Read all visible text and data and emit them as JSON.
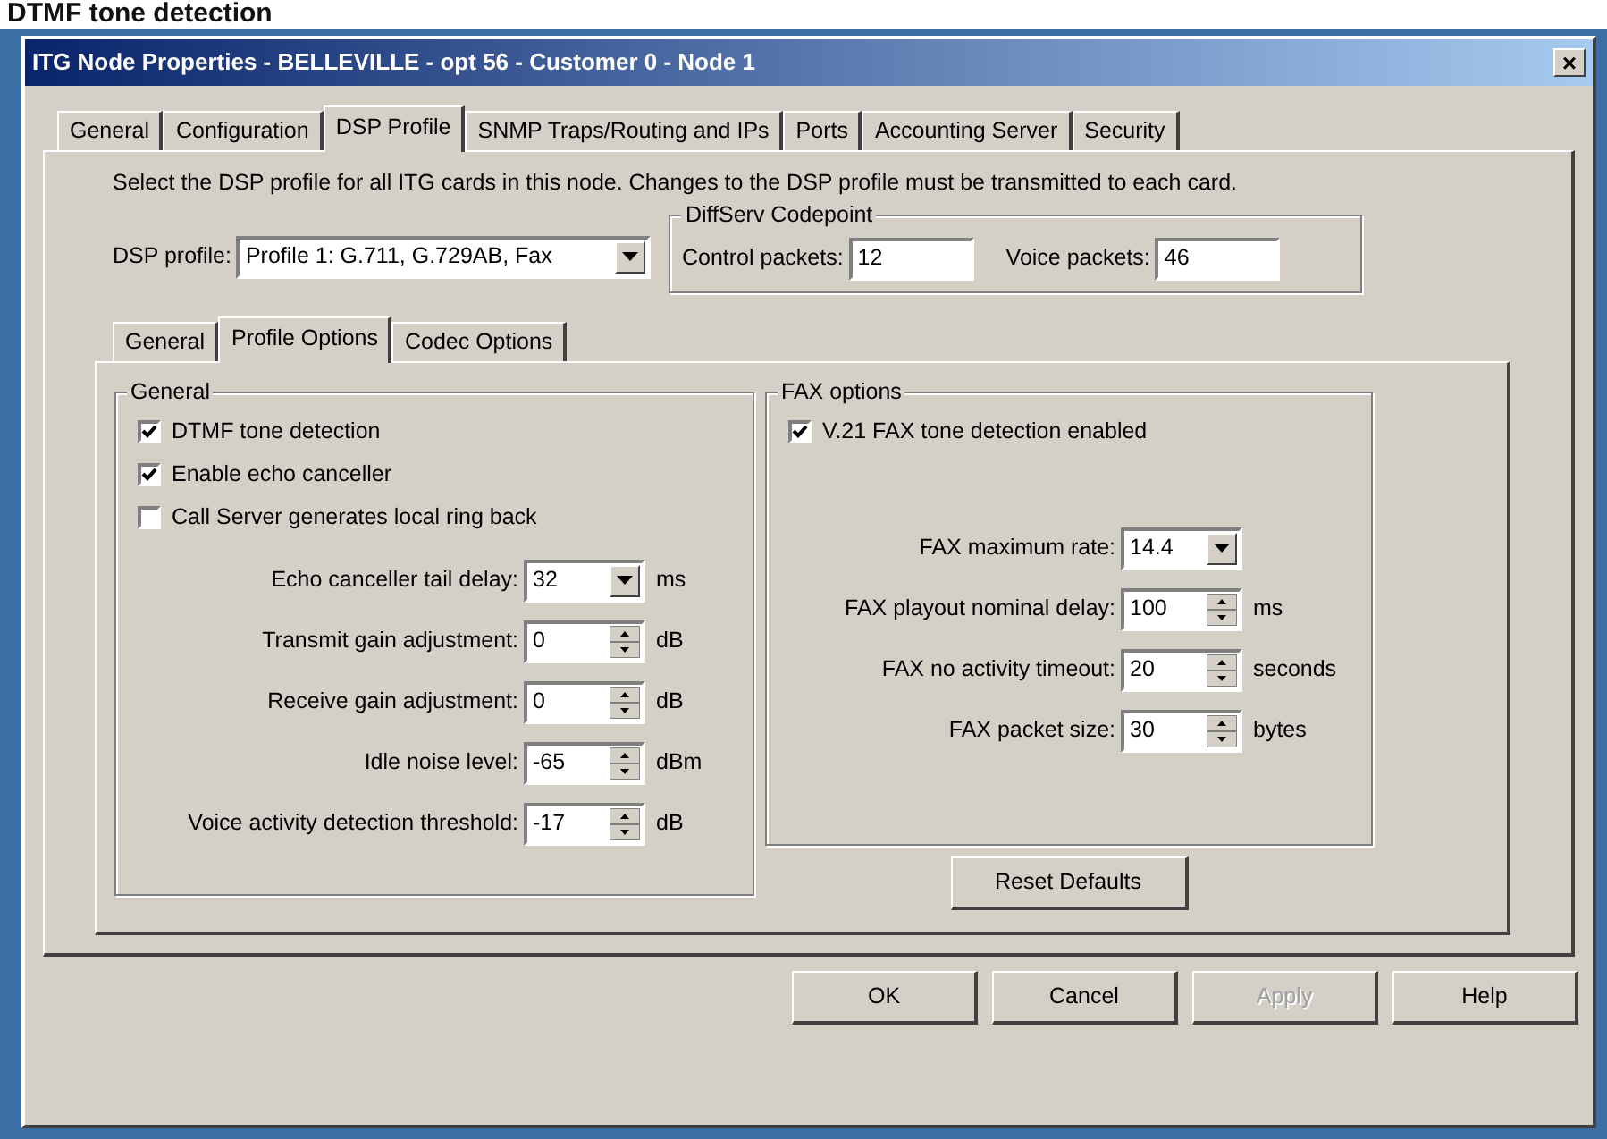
{
  "page_heading": "DTMF tone detection",
  "window": {
    "title": "ITG Node Properties - BELLEVILLE - opt 56 - Customer 0 - Node 1",
    "close": "×"
  },
  "tabs": [
    {
      "label": "General",
      "selected": false
    },
    {
      "label": "Configuration",
      "selected": false
    },
    {
      "label": "DSP Profile",
      "selected": true
    },
    {
      "label": "SNMP Traps/Routing and IPs",
      "selected": false
    },
    {
      "label": "Ports",
      "selected": false
    },
    {
      "label": "Accounting Server",
      "selected": false
    },
    {
      "label": "Security",
      "selected": false
    }
  ],
  "instructions": "Select the DSP profile for all ITG cards in this node. Changes to the DSP profile must be transmitted to each card.",
  "dsp_profile": {
    "label": "DSP profile:",
    "value": "Profile 1: G.711, G.729AB, Fax"
  },
  "diffserv": {
    "title": "DiffServ Codepoint",
    "fields": [
      {
        "label": "Control packets:",
        "value": "12"
      },
      {
        "label": "Voice packets:",
        "value": "46"
      }
    ]
  },
  "sub_tabs": [
    {
      "label": "General",
      "selected": false
    },
    {
      "label": "Profile Options",
      "selected": true
    },
    {
      "label": "Codec Options",
      "selected": false
    }
  ],
  "general_group": {
    "title": "General",
    "checkboxes": [
      {
        "label": "DTMF tone detection",
        "checked": true
      },
      {
        "label": "Enable echo canceller",
        "checked": true
      },
      {
        "label": "Call Server generates local ring back",
        "checked": false
      }
    ],
    "fields": [
      {
        "kind": "dropdown",
        "label": "Echo canceller tail delay:",
        "value": "32",
        "unit": "ms"
      },
      {
        "kind": "spinner",
        "label": "Transmit gain adjustment:",
        "value": "0",
        "unit": "dB"
      },
      {
        "kind": "spinner",
        "label": "Receive gain adjustment:",
        "value": "0",
        "unit": "dB"
      },
      {
        "kind": "spinner",
        "label": "Idle noise level:",
        "value": "-65",
        "unit": "dBm"
      },
      {
        "kind": "spinner",
        "label": "Voice activity detection threshold:",
        "value": "-17",
        "unit": "dB"
      }
    ]
  },
  "fax_group": {
    "title": "FAX options",
    "checkboxes": [
      {
        "label": "V.21 FAX tone detection enabled",
        "checked": true
      }
    ],
    "fields": [
      {
        "kind": "dropdown",
        "label": "FAX maximum rate:",
        "value": "14.4"
      },
      {
        "kind": "spinner",
        "label": "FAX playout nominal delay:",
        "value": "100",
        "unit": "ms"
      },
      {
        "kind": "spinner",
        "label": "FAX no activity timeout:",
        "value": "20",
        "unit": "seconds"
      },
      {
        "kind": "spinner",
        "label": "FAX packet size:",
        "value": "30",
        "unit": "bytes"
      }
    ]
  },
  "reset_button": "Reset Defaults",
  "buttons": [
    {
      "label": "OK",
      "disabled": false
    },
    {
      "label": "Cancel",
      "disabled": false
    },
    {
      "label": "Apply",
      "disabled": true
    },
    {
      "label": "Help",
      "disabled": false
    }
  ]
}
